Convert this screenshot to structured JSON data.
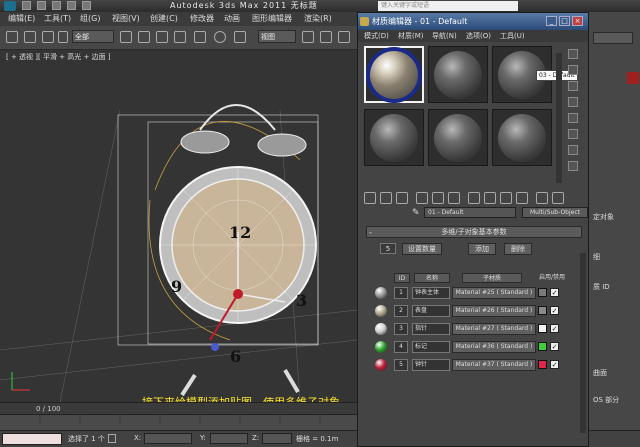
{
  "app": {
    "title": "Autodesk 3ds Max  2011    无标题",
    "search_placeholder": "键入关键字或短语"
  },
  "menu": [
    "编辑(E)",
    "工具(T)",
    "组(G)",
    "视图(V)",
    "创建(C)",
    "修改器",
    "动画",
    "图形编辑器",
    "渲染(R)"
  ],
  "toolbar": {
    "selection_filter": "全部",
    "reference_coord": "视图"
  },
  "viewport": {
    "label": "[ + 透视 ][ 平滑 + 高光 + 边面 ]"
  },
  "caption": "接下来给模型添加贴图，使用多维子对象，如图所示。",
  "timeline": {
    "frame": "0 / 100"
  },
  "status": {
    "selected": "选择了 1 个",
    "x_label": "X:",
    "y_label": "Y:",
    "z_label": "Z:",
    "grid": "栅格 = 0.1m"
  },
  "material_editor": {
    "title": "材质编辑器 - 01 - Default",
    "menu": [
      "模式(D)",
      "材质(M)",
      "导航(N)",
      "选项(O)",
      "工具(U)"
    ],
    "tooltip": "03 - Default",
    "material_name": "01 - Default",
    "material_type": "Multi/Sub-Object",
    "rollout_title": "多维/子对象基本参数",
    "count": "5",
    "set_count_label": "设置数量",
    "add_label": "添加",
    "delete_label": "删除",
    "headers": {
      "id": "ID",
      "name": "名称",
      "submaterial": "子材质",
      "toggle": "启用/禁用"
    },
    "rows": [
      {
        "id": "1",
        "name": "钟表主体",
        "material": "Material #25  ( Standard )",
        "color": "#7a7a7a",
        "ball": "#9a9a9a"
      },
      {
        "id": "2",
        "name": "表盘",
        "material": "Material #26  ( Standard )",
        "color": "#8a8a8a",
        "ball": "#b0a890"
      },
      {
        "id": "3",
        "name": "指针",
        "material": "Material #27  ( Standard )",
        "color": "#f2f2f2",
        "ball": "#d0d0d0"
      },
      {
        "id": "4",
        "name": "标记",
        "material": "Material #36  ( Standard )",
        "color": "#3ecf3e",
        "ball": "#2fa82f"
      },
      {
        "id": "5",
        "name": "钟针",
        "material": "Material #37  ( Standard )",
        "color": "#e0264a",
        "ball": "#c0203e"
      }
    ]
  },
  "right_panel": {
    "items": [
      "定对象",
      "细",
      "质 ID",
      "曲面",
      "OS 部分"
    ]
  }
}
